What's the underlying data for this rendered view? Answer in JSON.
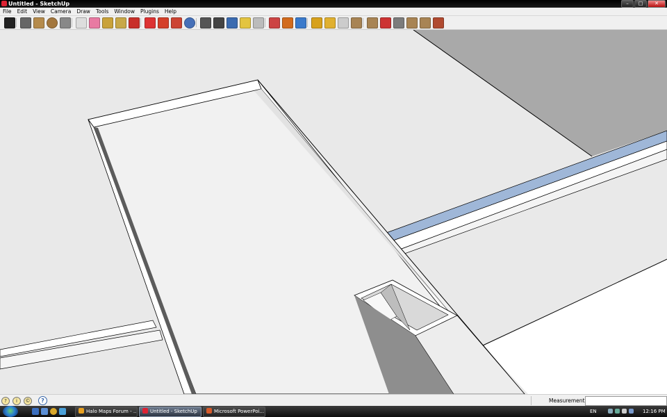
{
  "window": {
    "title": "Untitled - SketchUp"
  },
  "menu": [
    "File",
    "Edit",
    "View",
    "Camera",
    "Draw",
    "Tools",
    "Window",
    "Plugins",
    "Help"
  ],
  "toolbar": {
    "tools": [
      {
        "name": "select-tool-icon",
        "color": "#222"
      },
      {
        "name": "line-tool-icon",
        "color": "#666"
      },
      {
        "name": "rectangle-tool-icon",
        "color": "#b58b4c"
      },
      {
        "name": "circle-tool-icon",
        "color": "#a3773e"
      },
      {
        "name": "arc-tool-icon",
        "color": "#888"
      },
      {
        "name": "make-component-icon",
        "color": "#ddd"
      },
      {
        "name": "eraser-tool-icon",
        "color": "#e87aa2"
      },
      {
        "name": "paint-bucket-icon",
        "color": "#c9a23a"
      },
      {
        "name": "tape-measure-icon",
        "color": "#c8a848"
      },
      {
        "name": "push-pull-tool-icon",
        "color": "#c8302a"
      },
      {
        "name": "move-tool-icon",
        "color": "#d33"
      },
      {
        "name": "rotate-tool-icon",
        "color": "#d4402a"
      },
      {
        "name": "follow-me-icon",
        "color": "#c43"
      },
      {
        "name": "orbit-tool-icon",
        "color": "#4670b8"
      },
      {
        "name": "pan-tool-icon",
        "color": "#555"
      },
      {
        "name": "zoom-tool-icon",
        "color": "#444"
      },
      {
        "name": "zoom-extents-icon",
        "color": "#3b6bb0"
      },
      {
        "name": "section-plane-icon",
        "color": "#e3c440"
      },
      {
        "name": "3d-warehouse-icon",
        "color": "#bbb"
      },
      {
        "name": "axes-tool-icon",
        "color": "#c44"
      },
      {
        "name": "position-camera-icon",
        "color": "#d26b1c"
      },
      {
        "name": "get-models-icon",
        "color": "#3a7acb"
      },
      {
        "name": "styles-icon",
        "color": "#d7a11c"
      },
      {
        "name": "shadow-icon",
        "color": "#e0b030"
      },
      {
        "name": "fog-icon",
        "color": "#ccc"
      },
      {
        "name": "layers-icon",
        "color": "#a88454"
      },
      {
        "name": "iso-view-icon",
        "color": "#a88454"
      },
      {
        "name": "top-view-icon",
        "color": "#c33"
      },
      {
        "name": "front-view-icon",
        "color": "#7c7c7c"
      },
      {
        "name": "right-view-icon",
        "color": "#a88454"
      },
      {
        "name": "back-view-icon",
        "color": "#a88454"
      },
      {
        "name": "left-view-icon",
        "color": "#b04a30"
      }
    ]
  },
  "status": {
    "measurements_label": "Measurements",
    "help_glyph": "?"
  },
  "taskbar": {
    "tasks": [
      {
        "label": "Halo Maps Forum - ...",
        "active": false,
        "icon_color": "#e8a020"
      },
      {
        "label": "Untitled - SketchUp",
        "active": true,
        "icon_color": "#d23"
      },
      {
        "label": "Microsoft PowerPoi...",
        "active": false,
        "icon_color": "#d65a2a"
      }
    ],
    "lang": "EN",
    "clock": "12:16 PM"
  }
}
